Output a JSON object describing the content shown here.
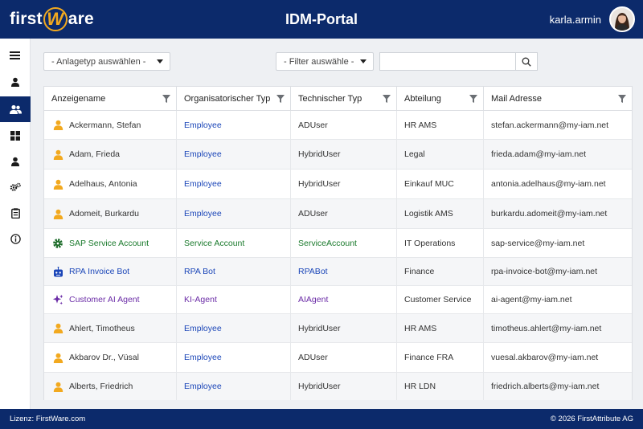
{
  "header": {
    "logo_left": "first",
    "logo_mid": "W",
    "logo_right": "are",
    "title": "IDM-Portal",
    "username": "karla.armin"
  },
  "sidebar": {
    "items": [
      {
        "icon": "menu-icon"
      },
      {
        "icon": "user-icon"
      },
      {
        "icon": "users-icon",
        "active": true
      },
      {
        "icon": "dashboard-icon"
      },
      {
        "icon": "person-icon"
      },
      {
        "icon": "settings-icon"
      },
      {
        "icon": "clipboard-icon"
      },
      {
        "icon": "info-icon"
      }
    ]
  },
  "toolbar": {
    "type_select": "- Anlagetyp auswählen -",
    "filter_select": "- Filter auswähle -",
    "search_value": ""
  },
  "table": {
    "columns": [
      "Anzeigename",
      "Organisatorischer Typ",
      "Technischer Typ",
      "Abteilung",
      "Mail Adresse"
    ],
    "rows": [
      {
        "icon": "person-icon",
        "kind": "person",
        "name": "Ackermann, Stefan",
        "org_type": "Employee",
        "tech_type": "ADUser",
        "department": "HR AMS",
        "mail": "stefan.ackermann@my-iam.net"
      },
      {
        "icon": "person-icon",
        "kind": "person",
        "name": "Adam, Frieda",
        "org_type": "Employee",
        "tech_type": "HybridUser",
        "department": "Legal",
        "mail": "frieda.adam@my-iam.net"
      },
      {
        "icon": "person-icon",
        "kind": "person",
        "name": "Adelhaus, Antonia",
        "org_type": "Employee",
        "tech_type": "HybridUser",
        "department": "Einkauf MUC",
        "mail": "antonia.adelhaus@my-iam.net"
      },
      {
        "icon": "person-icon",
        "kind": "person",
        "name": "Adomeit, Burkardu",
        "org_type": "Employee",
        "tech_type": "ADUser",
        "department": "Logistik AMS",
        "mail": "burkardu.adomeit@my-iam.net"
      },
      {
        "icon": "gear-icon",
        "kind": "service",
        "name": "SAP Service Account",
        "org_type": "Service Account",
        "tech_type": "ServiceAccount",
        "department": "IT Operations",
        "mail": "sap-service@my-iam.net"
      },
      {
        "icon": "robot-icon",
        "kind": "bot",
        "name": "RPA Invoice Bot",
        "org_type": "RPA Bot",
        "tech_type": "RPABot",
        "department": "Finance",
        "mail": "rpa-invoice-bot@my-iam.net"
      },
      {
        "icon": "sparkle-icon",
        "kind": "ai",
        "name": "Customer AI Agent",
        "org_type": "KI-Agent",
        "tech_type": "AIAgent",
        "department": "Customer Service",
        "mail": "ai-agent@my-iam.net"
      },
      {
        "icon": "person-icon",
        "kind": "person",
        "name": "Ahlert, Timotheus",
        "org_type": "Employee",
        "tech_type": "HybridUser",
        "department": "HR AMS",
        "mail": "timotheus.ahlert@my-iam.net"
      },
      {
        "icon": "person-icon",
        "kind": "person",
        "name": "Akbarov Dr., Vüsal",
        "org_type": "Employee",
        "tech_type": "ADUser",
        "department": "Finance FRA",
        "mail": "vuesal.akbarov@my-iam.net"
      },
      {
        "icon": "person-icon",
        "kind": "person",
        "name": "Alberts, Friedrich",
        "org_type": "Employee",
        "tech_type": "HybridUser",
        "department": "HR LDN",
        "mail": "friedrich.alberts@my-iam.net"
      }
    ]
  },
  "footer": {
    "license": "Lizenz: FirstWare.com",
    "copyright": "© 2026 FirstAttribute AG"
  },
  "colors": {
    "navy": "#0c2a6b",
    "accent": "#f2a91f",
    "link_blue": "#1b46b8",
    "service_green": "#1a7a2c",
    "ai_purple": "#6a2ba6"
  }
}
